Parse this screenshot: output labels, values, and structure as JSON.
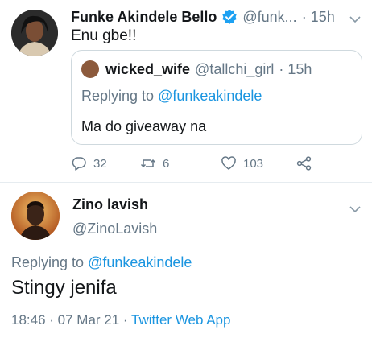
{
  "tweet1": {
    "author_name": "Funke Akindele Bello",
    "handle_truncated": "@funk...",
    "time": "· 15h",
    "text": "Enu gbe!!",
    "quote": {
      "author_name": "wicked_wife",
      "handle": "@tallchi_girl",
      "time": "· 15h",
      "replying_prefix": "Replying to ",
      "replying_handle": "@funkeakindele",
      "text": "Ma do giveaway na"
    },
    "actions": {
      "replies": "32",
      "retweets": "6",
      "likes": "103"
    }
  },
  "tweet2": {
    "author_name": "Zino lavish",
    "handle": "@ZinoLavish",
    "replying_prefix": "Replying to ",
    "replying_handle": "@funkeakindele",
    "text": "Stingy jenifa",
    "time_date": "18:46 · 07 Mar 21 · ",
    "source": "Twitter Web App"
  },
  "colors": {
    "link": "#1b95e0",
    "secondary_text": "#657786",
    "verified_badge": "#1da1f2"
  },
  "icons": [
    "verified-badge-icon",
    "chevron-down-icon",
    "reply-icon",
    "retweet-icon",
    "like-icon",
    "share-icon"
  ]
}
